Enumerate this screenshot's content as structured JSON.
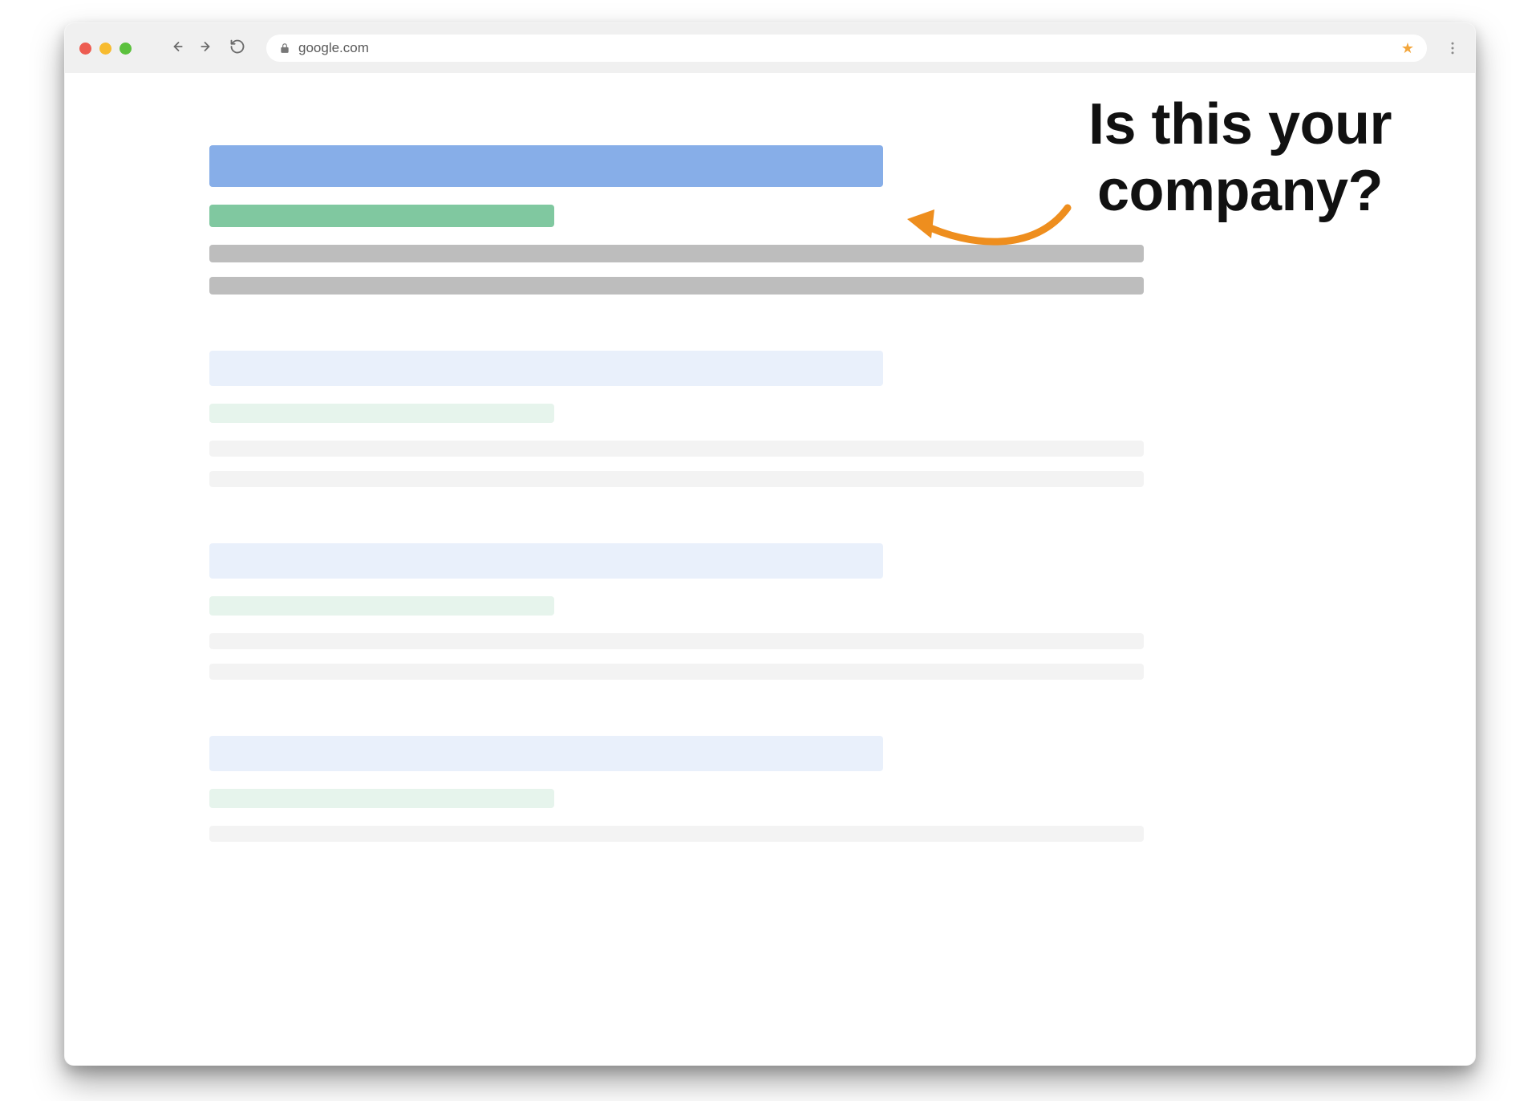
{
  "browser": {
    "url": "google.com"
  },
  "callout": {
    "line1": "Is this your",
    "line2": "company?"
  },
  "colors": {
    "result_title": "#87aee8",
    "result_url": "#80c8a0",
    "result_snippet": "#bdbdbd",
    "faded_title": "#e9f0fb",
    "faded_url": "#e6f4ec",
    "faded_snippet": "#f3f3f3",
    "accent_arrow": "#ee8e1e"
  }
}
